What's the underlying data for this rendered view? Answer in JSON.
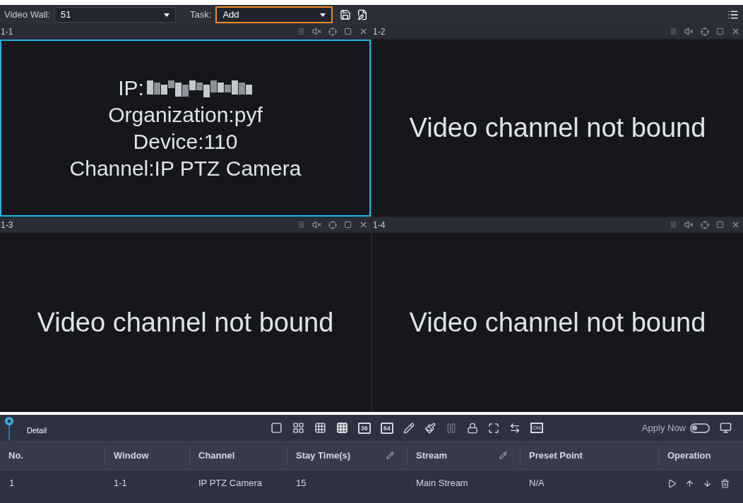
{
  "toolbar": {
    "video_wall_label": "Video Wall:",
    "video_wall_value": "51",
    "task_label": "Task:",
    "task_value": "Add",
    "task_focused": true
  },
  "panes": [
    {
      "label": "1-1",
      "selected": true,
      "kind": "bound",
      "lines": [
        "IP:",
        "Organization:pyf",
        "Device:110",
        "Channel:IP PTZ Camera"
      ]
    },
    {
      "label": "1-2",
      "selected": false,
      "kind": "empty",
      "lines": [
        "Video channel not bound"
      ]
    },
    {
      "label": "1-3",
      "selected": false,
      "kind": "empty",
      "lines": [
        "Video channel not bound"
      ]
    },
    {
      "label": "1-4",
      "selected": false,
      "kind": "empty",
      "lines": [
        "Video channel not bound"
      ]
    }
  ],
  "detail": {
    "title": "Detail",
    "layout_labels": [
      "36",
      "64"
    ],
    "monitor_label": "ON",
    "apply_now_label": "Apply Now",
    "apply_now_on": false
  },
  "table": {
    "columns": [
      {
        "label": "No.",
        "editable": false
      },
      {
        "label": "Window",
        "editable": false
      },
      {
        "label": "Channel",
        "editable": false
      },
      {
        "label": "Stay Time(s)",
        "editable": true
      },
      {
        "label": "Stream",
        "editable": true
      },
      {
        "label": "Preset Point",
        "editable": false
      },
      {
        "label": "Operation",
        "editable": false
      }
    ],
    "rows": [
      {
        "cells": [
          "1",
          "1-1",
          "IP PTZ Camera",
          "15",
          "Main Stream",
          "N/A"
        ]
      }
    ]
  }
}
